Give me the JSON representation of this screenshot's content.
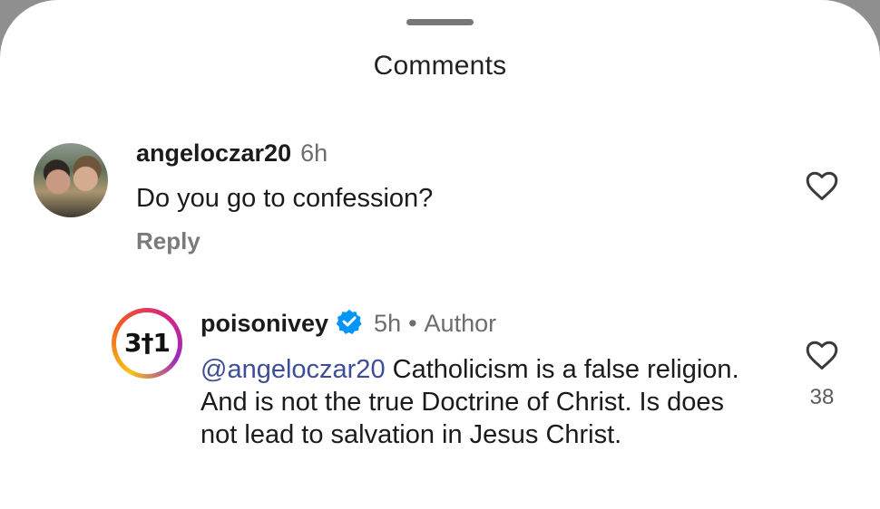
{
  "sheet": {
    "title": "Comments"
  },
  "comments": [
    {
      "username": "angeloczar20",
      "time": "6h",
      "text": "Do you go to confession?",
      "reply_label": "Reply",
      "avatar_icon": "profile-photo-icon",
      "like_icon": "heart-outline-icon"
    }
  ],
  "replies": [
    {
      "username": "poisonivey",
      "verified": true,
      "time": "5h",
      "separator": "•",
      "role": "Author",
      "mention": "@angeloczar20",
      "text": " Catholicism is a false religion. And is not the true Doctrine of Christ. Is does not lead to salvation in Jesus Christ.",
      "avatar_text": "3†1",
      "like_count": "38",
      "avatar_icon": "story-ring-avatar-icon",
      "like_icon": "heart-outline-icon"
    }
  ],
  "colors": {
    "background": "#ffffff",
    "text": "#1b1b1b",
    "secondary_text": "#6d6d6d",
    "mention": "#3d4d97",
    "verified": "#0095f6"
  }
}
